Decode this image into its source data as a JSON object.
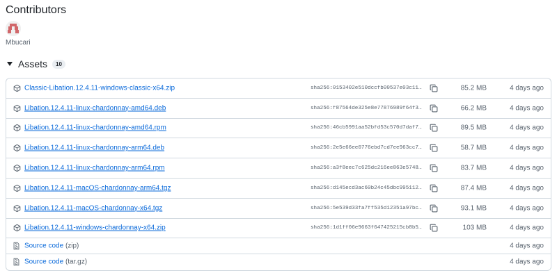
{
  "contributors": {
    "title": "Contributors",
    "users": [
      {
        "name": "Mbucari"
      }
    ]
  },
  "assets": {
    "label": "Assets",
    "count": "10",
    "items": [
      {
        "name": "Classic-Libation.12.4.11-windows-classic-x64.zip",
        "sha": "sha256:0153402e510dccfb00537e03c11a5",
        "size": "85.2 MB",
        "date": "4 days ago",
        "icon": "package-icon"
      },
      {
        "name": "Libation.12.4.11-linux-chardonnay-amd64.deb",
        "sha": "sha256:f87564de325e8e77876989f64f387",
        "size": "66.2 MB",
        "date": "4 days ago",
        "icon": "package-icon"
      },
      {
        "name": "Libation.12.4.11-linux-chardonnay-amd64.rpm",
        "sha": "sha256:46cb5991aa52bfd53c570d7daf719",
        "size": "89.5 MB",
        "date": "4 days ago",
        "icon": "package-icon"
      },
      {
        "name": "Libation.12.4.11-linux-chardonnay-arm64.deb",
        "sha": "sha256:2e5e66ee0776ebd7cd7ee963cc71d",
        "size": "58.7 MB",
        "date": "4 days ago",
        "icon": "package-icon"
      },
      {
        "name": "Libation.12.4.11-linux-chardonnay-arm64.rpm",
        "sha": "sha256:a3f8eec7c625dc216ee863e574809",
        "size": "83.7 MB",
        "date": "4 days ago",
        "icon": "package-icon"
      },
      {
        "name": "Libation.12.4.11-macOS-chardonnay-arm64.tgz",
        "sha": "sha256:d145ecd3ac60b24c45dbc99511201",
        "size": "87.4 MB",
        "date": "4 days ago",
        "icon": "package-icon"
      },
      {
        "name": "Libation.12.4.11-macOS-chardonnay-x64.tgz",
        "sha": "sha256:5e539d33fa7ff535d12351a97bc86",
        "size": "93.1 MB",
        "date": "4 days ago",
        "icon": "package-icon"
      },
      {
        "name": "Libation.12.4.11-windows-chardonnay-x64.zip",
        "sha": "sha256:1d1ff06e9663f647425215cb8b550",
        "size": "103 MB",
        "date": "4 days ago",
        "icon": "package-icon"
      }
    ],
    "source": [
      {
        "name": "Source code",
        "format": "(zip)",
        "date": "4 days ago",
        "icon": "file-zip-icon"
      },
      {
        "name": "Source code",
        "format": "(tar.gz)",
        "date": "4 days ago",
        "icon": "file-zip-icon"
      }
    ]
  }
}
